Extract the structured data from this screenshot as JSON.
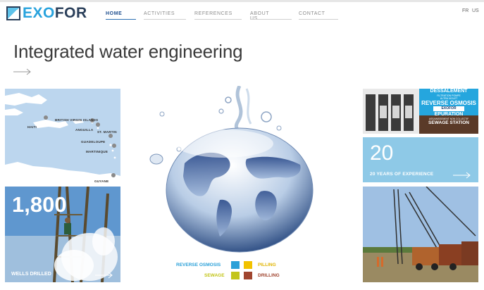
{
  "brand": {
    "part1": "EXO",
    "part2": "FOR"
  },
  "nav": [
    {
      "label": "HOME",
      "active": true
    },
    {
      "label": "ACTIVITIES",
      "active": false
    },
    {
      "label": "REFERENCES",
      "active": false
    },
    {
      "label": "ABOUT US",
      "active": false
    },
    {
      "label": "CONTACT",
      "active": false
    }
  ],
  "lang": {
    "fr": "FR",
    "us": "US"
  },
  "hero": {
    "title": "Integrated water engineering"
  },
  "map": {
    "places": [
      "HAITI",
      "BRITISH VIRGIN ISLANDS",
      "ANGUILLA",
      "ST. MARTIN",
      "GUADELOUPE",
      "MARTINIQUE",
      "GUYANE"
    ]
  },
  "wells": {
    "value": "1,800",
    "caption": "WELLS DRILLED"
  },
  "experience": {
    "value": "20",
    "caption": "20 YEARS OF EXPERIENCE"
  },
  "signboard": {
    "line1": "DESSALEMENT",
    "line2": "FILTRATION    POMPE",
    "line3": "ULTRA VIOLET",
    "line4": "REVERSE OSMOSIS",
    "line5": "EXOFOR",
    "line6": "EPURATION",
    "line7": "ASSAINISSEMENT NON COLLECTIF",
    "line8": "SEWAGE STATION"
  },
  "legend": {
    "reverse_osmosis": "REVERSE OSMOSIS",
    "pilling": "PILLING",
    "sewage": "SEWAGE",
    "drilling": "DRILLING"
  },
  "colors": {
    "brand_blue": "#29a3dd",
    "brand_navy": "#2a3f5a",
    "legend_blue": "#2aa0d8",
    "legend_yellow": "#f2c200",
    "legend_olive": "#c3c51a",
    "legend_red": "#a0452f",
    "experience_tile": "#8ec9e7"
  }
}
